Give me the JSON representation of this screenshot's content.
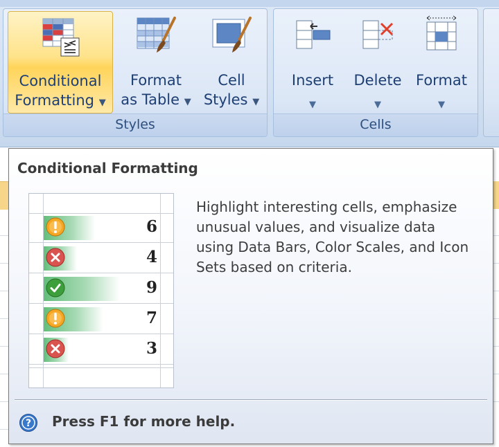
{
  "ribbon": {
    "styles_group": {
      "label": "Styles",
      "conditional_formatting": {
        "line1": "Conditional",
        "line2": "Formatting"
      },
      "format_as_table": {
        "line1": "Format",
        "line2": "as Table"
      },
      "cell_styles": {
        "line1": "Cell",
        "line2": "Styles"
      }
    },
    "cells_group": {
      "label": "Cells",
      "insert": "Insert",
      "delete": "Delete",
      "format": "Format"
    }
  },
  "tooltip": {
    "title": "Conditional Formatting",
    "description": "Highlight interesting cells, emphasize unusual values, and visualize data using Data Bars, Color Scales, and Icon Sets based on criteria.",
    "help": "Press F1 for more help.",
    "preview_rows": [
      {
        "value": "6",
        "icon": "warning-icon",
        "bar_fraction": 0.67
      },
      {
        "value": "4",
        "icon": "error-icon",
        "bar_fraction": 0.44
      },
      {
        "value": "9",
        "icon": "check-icon",
        "bar_fraction": 1.0
      },
      {
        "value": "7",
        "icon": "warning-icon",
        "bar_fraction": 0.78
      },
      {
        "value": "3",
        "icon": "error-icon",
        "bar_fraction": 0.33
      }
    ]
  },
  "colors": {
    "warning": "#f5a623",
    "error": "#d9534f",
    "ok": "#3c9f3c",
    "data_bar": "#63be7b",
    "active_button": "#ffd45a"
  }
}
